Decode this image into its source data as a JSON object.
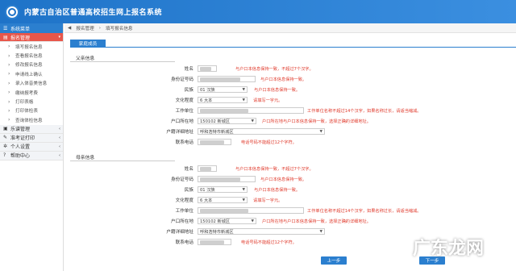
{
  "header": {
    "title": "内蒙古自治区普通高校招生网上报名系统"
  },
  "sidebar": {
    "head": "系统菜单",
    "groups": [
      {
        "label": "报名管理",
        "items": [
          "填写报名信息",
          "查看报名信息",
          "修改报名信息",
          "申请线上确认",
          "录入体音美信息",
          "缴纳报考费",
          "打印表格",
          "打印体检表",
          "查询体检信息"
        ]
      },
      {
        "label": "乐谱管理"
      },
      {
        "label": "准考证打印"
      },
      {
        "label": "个人设置"
      },
      {
        "label": "帮助中心"
      }
    ]
  },
  "breadcrumb": {
    "a": "报名管理",
    "b": "填写报名信息"
  },
  "tab": "家庭成员",
  "father": {
    "title": "父亲信息",
    "labels": [
      "姓名",
      "身份证号码",
      "民族",
      "文化程度",
      "工作单位",
      "户口所在地",
      "户籍详细地址",
      "联系电话"
    ],
    "values": {
      "nation": "01 汉族",
      "edu": "6 大本",
      "hukou": "150102 新城区",
      "addr": "呼和浩特市新城区"
    },
    "hints": [
      "与户口本信息保持一致，不超过7个汉字。",
      "与户口本信息保持一致。",
      "与户口本信息保持一致。",
      "请填写一字元。",
      "工作单位名称不超过14个汉字，如果名称过长，请适当缩减。",
      "户口所在地与户口本信息保持一致，选择正确的详细地址。",
      "电话号码不能超过12个字符。"
    ]
  },
  "mother": {
    "title": "母亲信息",
    "labels": [
      "姓名",
      "身份证号码",
      "民族",
      "文化程度",
      "工作单位",
      "户口所在地",
      "户籍详细地址",
      "联系电话"
    ],
    "values": {
      "nation": "01 汉族",
      "edu": "6 大本",
      "hukou": "150102 新城区",
      "addr": "呼和浩特市新城区"
    },
    "hints": [
      "与户口本信息保持一致，不超过7个汉字。",
      "与户口本信息保持一致。",
      "与户口本信息保持一致。",
      "请填写一字元。",
      "工作单位名称不超过14个汉字，如果名称过长，请适当缩减。",
      "户口所在地与户口本信息保持一致，选择正确的详细地址。",
      "电话号码不能超过12个字符。"
    ]
  },
  "buttons": {
    "prev": "上一步",
    "next": "下一步"
  },
  "watermark": "广东龙网"
}
